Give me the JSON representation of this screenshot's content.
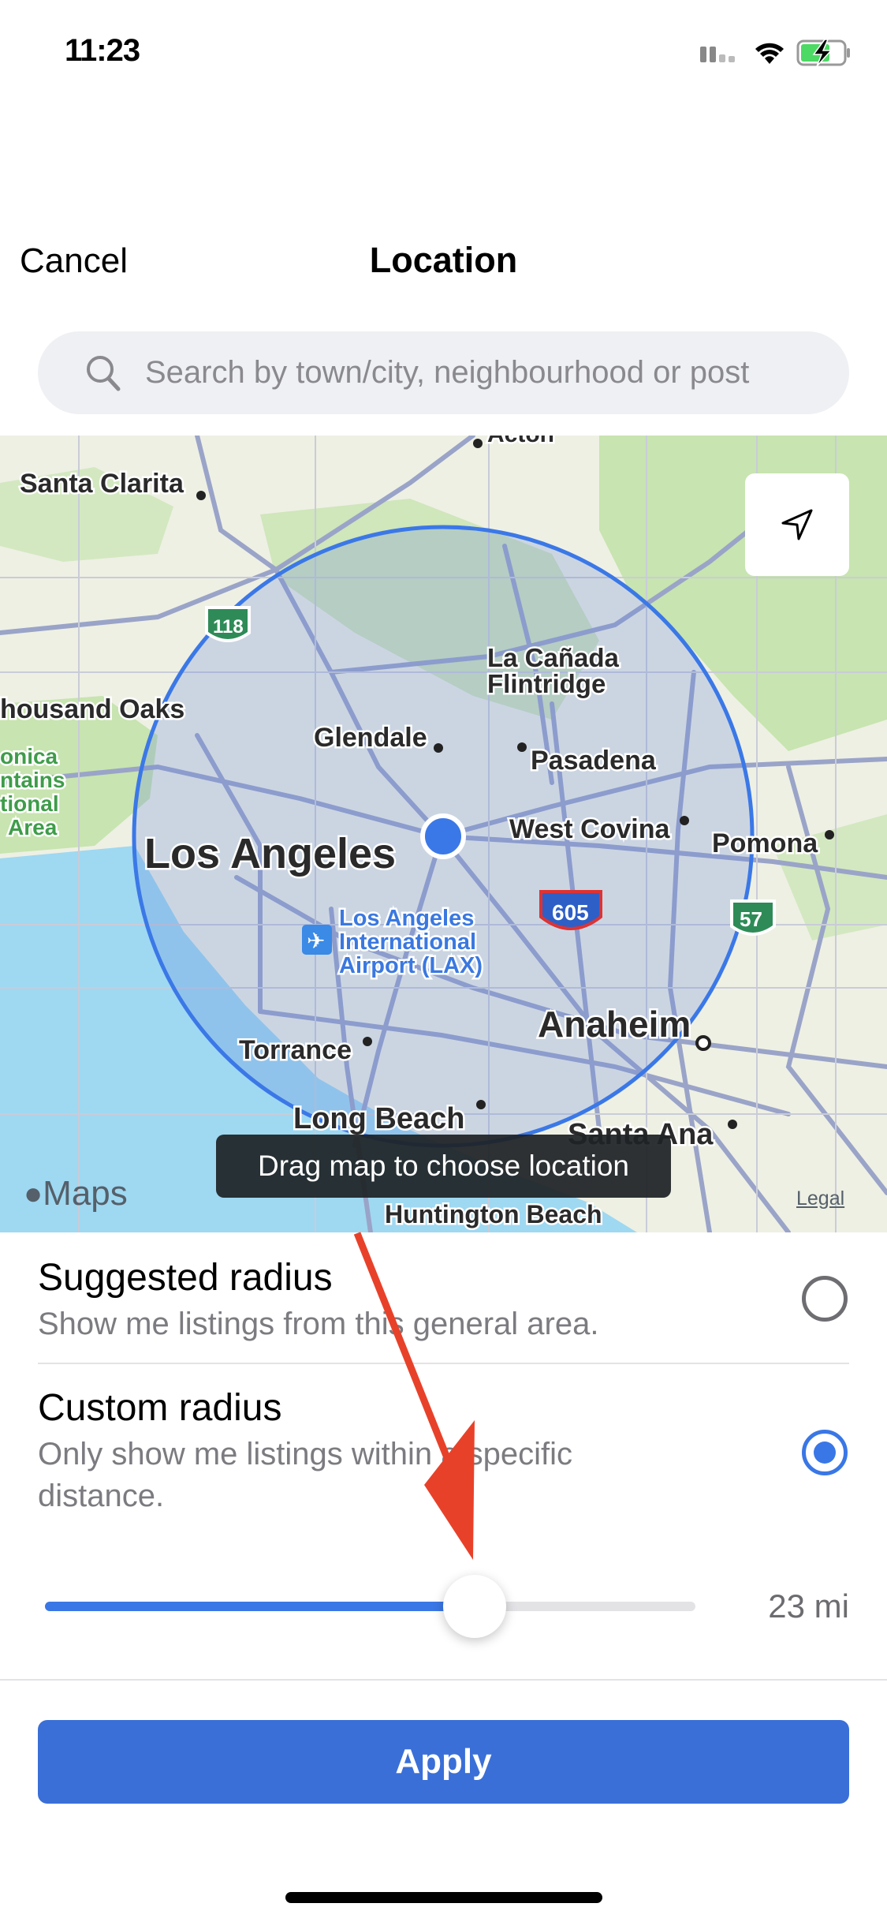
{
  "status_bar": {
    "time": "11:23",
    "icons": [
      "cellular-signal-icon",
      "wifi-icon",
      "battery-charging-icon"
    ]
  },
  "nav": {
    "cancel_label": "Cancel",
    "title": "Location"
  },
  "search": {
    "placeholder": "Search by town/city, neighbourhood or post",
    "value": ""
  },
  "map": {
    "labels": {
      "acton": "Acton",
      "santa_clarita": "Santa Clarita",
      "thousand_oaks": "housand Oaks",
      "smm1": "onica",
      "smm2": "ntains",
      "smm3": "tional",
      "smm4": "Area",
      "la_canada_1": "La Cañada",
      "la_canada_2": "Flintridge",
      "glendale": "Glendale",
      "pasadena": "Pasadena",
      "west_covina": "West Covina",
      "pomona": "Pomona",
      "los_angeles": "Los Angeles",
      "lax_1": "Los Angeles",
      "lax_2": "International",
      "lax_3": "Airport (LAX)",
      "torrance": "Torrance",
      "anaheim": "Anaheim",
      "long_beach": "Long Beach",
      "santa_ana": "Santa Ana",
      "huntington_beach": "Huntington Beach"
    },
    "shields": {
      "r118": "118",
      "i605": "605",
      "r57": "57"
    },
    "attribution": "Maps",
    "legal": "Legal",
    "tooltip": "Drag map to choose location",
    "colors": {
      "land": "#eef0e4",
      "water": "#9fd8f1",
      "park": "#c8e4b0",
      "radius": "#3b78e7"
    }
  },
  "options": [
    {
      "title": "Suggested radius",
      "subtitle": "Show me listings from this general area.",
      "selected": false
    },
    {
      "title": "Custom radius",
      "subtitle": "Only show me listings within a specific distance.",
      "selected": true
    }
  ],
  "slider": {
    "value_label": "23 mi",
    "fraction": 0.66
  },
  "apply_label": "Apply",
  "accent": "#3a6fd8"
}
